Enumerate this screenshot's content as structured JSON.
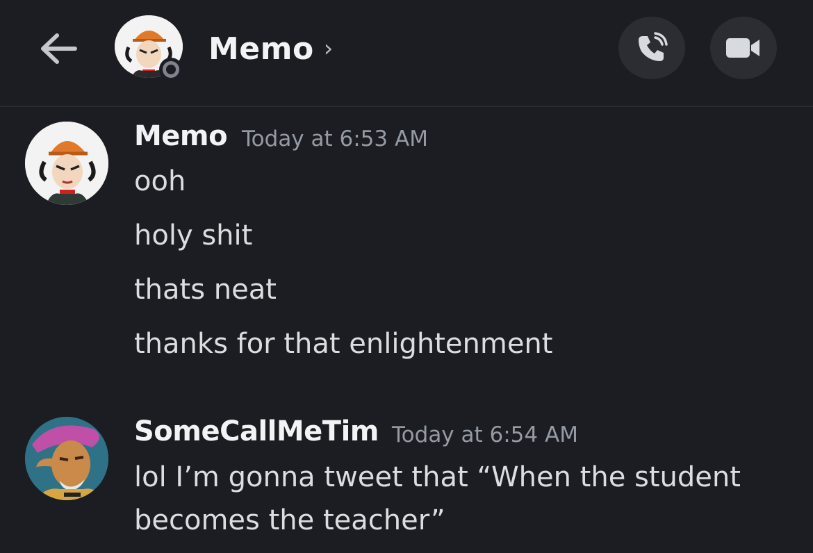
{
  "header": {
    "title": "Memo",
    "chevron": "›",
    "back_icon": "arrow-left-icon",
    "call_icon": "phone-icon",
    "video_icon": "video-camera-icon",
    "status": "offline"
  },
  "colors": {
    "background": "#1c1d22",
    "button_bg": "#2b2d33",
    "username": "#f2f3f5",
    "timestamp": "#949ba4",
    "message_text": "#dbdee1"
  },
  "messages": [
    {
      "author": "Memo",
      "timestamp": "Today at 6:53 AM",
      "lines": [
        "ooh",
        "holy shit",
        "thats neat",
        "thanks for that enlightenment"
      ]
    },
    {
      "author": "SomeCallMeTim",
      "timestamp": "Today at 6:54 AM",
      "lines": [
        "lol I’m gonna tweet that “When the student",
        "becomes the teacher”"
      ]
    }
  ]
}
